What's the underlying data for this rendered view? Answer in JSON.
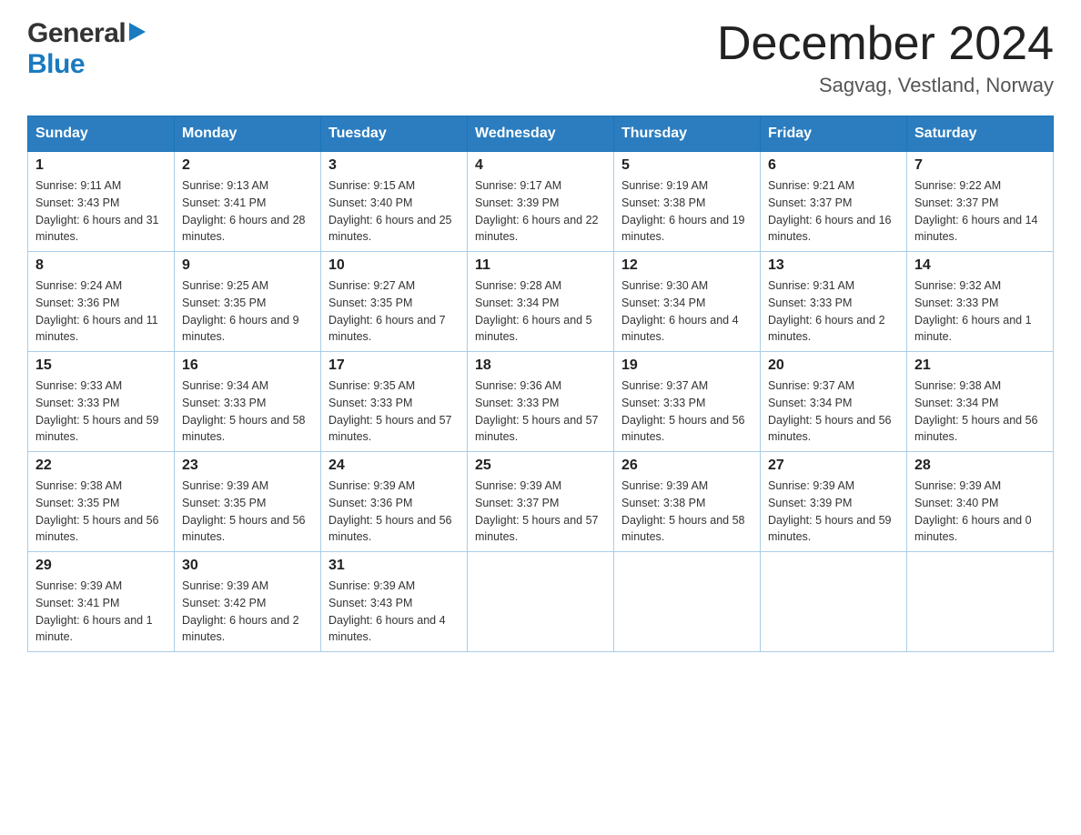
{
  "header": {
    "logo_general": "General",
    "logo_blue": "Blue",
    "month_title": "December 2024",
    "location": "Sagvag, Vestland, Norway"
  },
  "days_of_week": [
    "Sunday",
    "Monday",
    "Tuesday",
    "Wednesday",
    "Thursday",
    "Friday",
    "Saturday"
  ],
  "weeks": [
    [
      {
        "day": "1",
        "sunrise": "Sunrise: 9:11 AM",
        "sunset": "Sunset: 3:43 PM",
        "daylight": "Daylight: 6 hours and 31 minutes."
      },
      {
        "day": "2",
        "sunrise": "Sunrise: 9:13 AM",
        "sunset": "Sunset: 3:41 PM",
        "daylight": "Daylight: 6 hours and 28 minutes."
      },
      {
        "day": "3",
        "sunrise": "Sunrise: 9:15 AM",
        "sunset": "Sunset: 3:40 PM",
        "daylight": "Daylight: 6 hours and 25 minutes."
      },
      {
        "day": "4",
        "sunrise": "Sunrise: 9:17 AM",
        "sunset": "Sunset: 3:39 PM",
        "daylight": "Daylight: 6 hours and 22 minutes."
      },
      {
        "day": "5",
        "sunrise": "Sunrise: 9:19 AM",
        "sunset": "Sunset: 3:38 PM",
        "daylight": "Daylight: 6 hours and 19 minutes."
      },
      {
        "day": "6",
        "sunrise": "Sunrise: 9:21 AM",
        "sunset": "Sunset: 3:37 PM",
        "daylight": "Daylight: 6 hours and 16 minutes."
      },
      {
        "day": "7",
        "sunrise": "Sunrise: 9:22 AM",
        "sunset": "Sunset: 3:37 PM",
        "daylight": "Daylight: 6 hours and 14 minutes."
      }
    ],
    [
      {
        "day": "8",
        "sunrise": "Sunrise: 9:24 AM",
        "sunset": "Sunset: 3:36 PM",
        "daylight": "Daylight: 6 hours and 11 minutes."
      },
      {
        "day": "9",
        "sunrise": "Sunrise: 9:25 AM",
        "sunset": "Sunset: 3:35 PM",
        "daylight": "Daylight: 6 hours and 9 minutes."
      },
      {
        "day": "10",
        "sunrise": "Sunrise: 9:27 AM",
        "sunset": "Sunset: 3:35 PM",
        "daylight": "Daylight: 6 hours and 7 minutes."
      },
      {
        "day": "11",
        "sunrise": "Sunrise: 9:28 AM",
        "sunset": "Sunset: 3:34 PM",
        "daylight": "Daylight: 6 hours and 5 minutes."
      },
      {
        "day": "12",
        "sunrise": "Sunrise: 9:30 AM",
        "sunset": "Sunset: 3:34 PM",
        "daylight": "Daylight: 6 hours and 4 minutes."
      },
      {
        "day": "13",
        "sunrise": "Sunrise: 9:31 AM",
        "sunset": "Sunset: 3:33 PM",
        "daylight": "Daylight: 6 hours and 2 minutes."
      },
      {
        "day": "14",
        "sunrise": "Sunrise: 9:32 AM",
        "sunset": "Sunset: 3:33 PM",
        "daylight": "Daylight: 6 hours and 1 minute."
      }
    ],
    [
      {
        "day": "15",
        "sunrise": "Sunrise: 9:33 AM",
        "sunset": "Sunset: 3:33 PM",
        "daylight": "Daylight: 5 hours and 59 minutes."
      },
      {
        "day": "16",
        "sunrise": "Sunrise: 9:34 AM",
        "sunset": "Sunset: 3:33 PM",
        "daylight": "Daylight: 5 hours and 58 minutes."
      },
      {
        "day": "17",
        "sunrise": "Sunrise: 9:35 AM",
        "sunset": "Sunset: 3:33 PM",
        "daylight": "Daylight: 5 hours and 57 minutes."
      },
      {
        "day": "18",
        "sunrise": "Sunrise: 9:36 AM",
        "sunset": "Sunset: 3:33 PM",
        "daylight": "Daylight: 5 hours and 57 minutes."
      },
      {
        "day": "19",
        "sunrise": "Sunrise: 9:37 AM",
        "sunset": "Sunset: 3:33 PM",
        "daylight": "Daylight: 5 hours and 56 minutes."
      },
      {
        "day": "20",
        "sunrise": "Sunrise: 9:37 AM",
        "sunset": "Sunset: 3:34 PM",
        "daylight": "Daylight: 5 hours and 56 minutes."
      },
      {
        "day": "21",
        "sunrise": "Sunrise: 9:38 AM",
        "sunset": "Sunset: 3:34 PM",
        "daylight": "Daylight: 5 hours and 56 minutes."
      }
    ],
    [
      {
        "day": "22",
        "sunrise": "Sunrise: 9:38 AM",
        "sunset": "Sunset: 3:35 PM",
        "daylight": "Daylight: 5 hours and 56 minutes."
      },
      {
        "day": "23",
        "sunrise": "Sunrise: 9:39 AM",
        "sunset": "Sunset: 3:35 PM",
        "daylight": "Daylight: 5 hours and 56 minutes."
      },
      {
        "day": "24",
        "sunrise": "Sunrise: 9:39 AM",
        "sunset": "Sunset: 3:36 PM",
        "daylight": "Daylight: 5 hours and 56 minutes."
      },
      {
        "day": "25",
        "sunrise": "Sunrise: 9:39 AM",
        "sunset": "Sunset: 3:37 PM",
        "daylight": "Daylight: 5 hours and 57 minutes."
      },
      {
        "day": "26",
        "sunrise": "Sunrise: 9:39 AM",
        "sunset": "Sunset: 3:38 PM",
        "daylight": "Daylight: 5 hours and 58 minutes."
      },
      {
        "day": "27",
        "sunrise": "Sunrise: 9:39 AM",
        "sunset": "Sunset: 3:39 PM",
        "daylight": "Daylight: 5 hours and 59 minutes."
      },
      {
        "day": "28",
        "sunrise": "Sunrise: 9:39 AM",
        "sunset": "Sunset: 3:40 PM",
        "daylight": "Daylight: 6 hours and 0 minutes."
      }
    ],
    [
      {
        "day": "29",
        "sunrise": "Sunrise: 9:39 AM",
        "sunset": "Sunset: 3:41 PM",
        "daylight": "Daylight: 6 hours and 1 minute."
      },
      {
        "day": "30",
        "sunrise": "Sunrise: 9:39 AM",
        "sunset": "Sunset: 3:42 PM",
        "daylight": "Daylight: 6 hours and 2 minutes."
      },
      {
        "day": "31",
        "sunrise": "Sunrise: 9:39 AM",
        "sunset": "Sunset: 3:43 PM",
        "daylight": "Daylight: 6 hours and 4 minutes."
      },
      null,
      null,
      null,
      null
    ]
  ]
}
